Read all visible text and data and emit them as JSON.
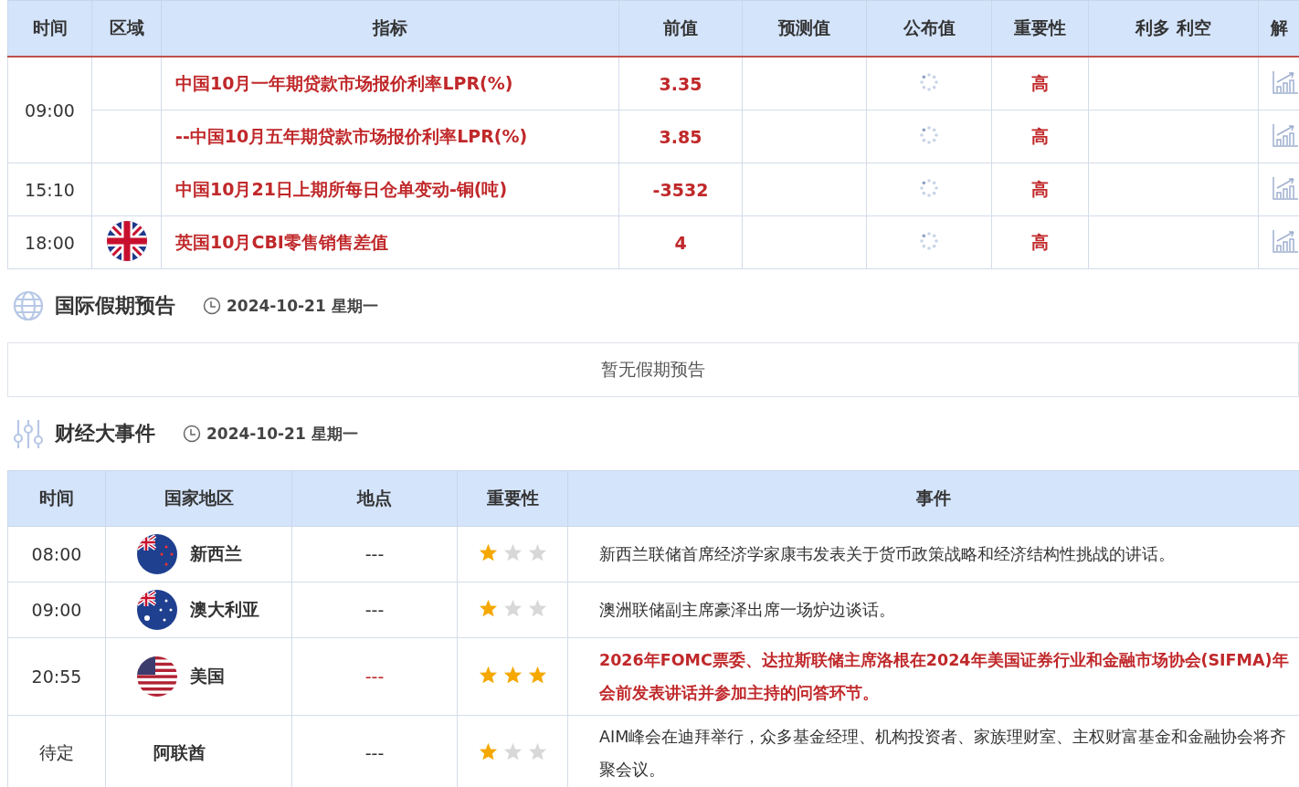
{
  "indicators": {
    "columns": [
      "时间",
      "区域",
      "指标",
      "前值",
      "预测值",
      "公布值",
      "重要性",
      "利多 利空",
      "解"
    ],
    "groups": [
      {
        "time": "09:00",
        "rows": [
          {
            "name": "中国10月一年期贷款市场报价利率LPR(%)",
            "previous": "3.35",
            "loading": true,
            "importance": "高"
          },
          {
            "name": "--中国10月五年期贷款市场报价利率LPR(%)",
            "previous": "3.85",
            "loading": true,
            "importance": "高"
          }
        ]
      },
      {
        "time": "15:10",
        "rows": [
          {
            "name": "中国10月21日上期所每日仓单变动-铜(吨)",
            "previous": "-3532",
            "loading": true,
            "importance": "高"
          }
        ]
      },
      {
        "time": "18:00",
        "rows": [
          {
            "kind": "uk",
            "name": "英国10月CBI零售销售差值",
            "previous": "4",
            "loading": true,
            "importance": "高"
          }
        ]
      }
    ]
  },
  "holidays": {
    "title": "国际假期预告",
    "date": "2024-10-21 星期一",
    "empty_text": "暂无假期预告"
  },
  "events": {
    "title": "财经大事件",
    "date": "2024-10-21 星期一",
    "columns": [
      "时间",
      "国家地区",
      "地点",
      "重要性",
      "事件"
    ],
    "rows": [
      {
        "time": "08:00",
        "kind": "nz",
        "country": "新西兰",
        "place": "---",
        "stars": 1,
        "highlight": false,
        "event": "新西兰联储首席经济学家康韦发表关于货币政策战略和经济结构性挑战的讲话。"
      },
      {
        "time": "09:00",
        "kind": "au",
        "country": "澳大利亚",
        "place": "---",
        "stars": 1,
        "highlight": false,
        "event": "澳洲联储副主席豪泽出席一场炉边谈话。"
      },
      {
        "time": "20:55",
        "kind": "us",
        "country": "美国",
        "place": "---",
        "stars": 3,
        "highlight": true,
        "event": "2026年FOMC票委、达拉斯联储主席洛根在2024年美国证券行业和金融市场协会(SIFMA)年会前发表讲话并参加主持的问答环节。"
      },
      {
        "time": "待定",
        "country": "阿联酋",
        "place": "---",
        "stars": 1,
        "highlight": false,
        "event": "AIM峰会在迪拜举行，众多基金经理、机构投资者、家族理财室、主权财富基金和金融协会将齐聚会议。"
      }
    ]
  }
}
